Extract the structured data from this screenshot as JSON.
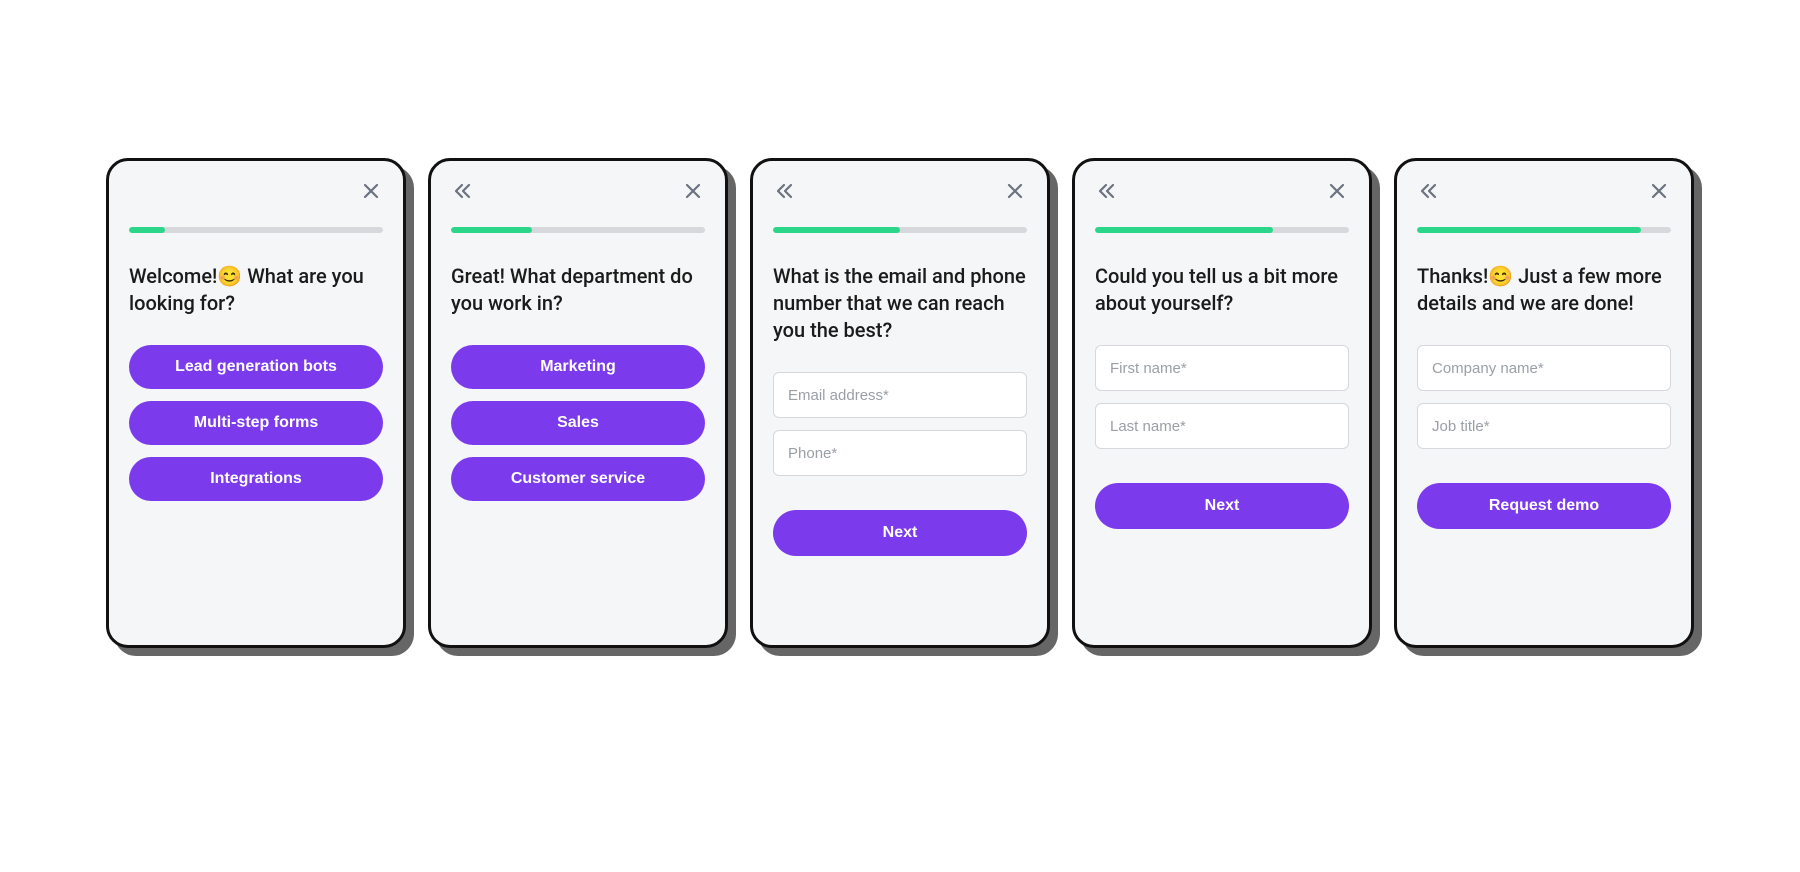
{
  "colors": {
    "accent": "#7c3aed",
    "progress": "#2bd68a",
    "track": "#d6d8dc"
  },
  "steps": [
    {
      "has_back": false,
      "progress_percent": 14,
      "prompt": "Welcome!😊 What are you looking for?",
      "type": "options",
      "options": [
        "Lead generation bots",
        "Multi-step forms",
        "Integrations"
      ]
    },
    {
      "has_back": true,
      "progress_percent": 32,
      "prompt": "Great! What department do you work in?",
      "type": "options",
      "options": [
        "Marketing",
        "Sales",
        "Customer service"
      ]
    },
    {
      "has_back": true,
      "progress_percent": 50,
      "prompt": "What is the email and phone number that we can reach you the best?",
      "type": "form",
      "fields": [
        {
          "placeholder": "Email address*"
        },
        {
          "placeholder": "Phone*"
        }
      ],
      "submit_label": "Next"
    },
    {
      "has_back": true,
      "progress_percent": 70,
      "prompt": "Could you tell us a bit more about yourself?",
      "type": "form",
      "fields": [
        {
          "placeholder": "First name*"
        },
        {
          "placeholder": "Last name*"
        }
      ],
      "submit_label": "Next"
    },
    {
      "has_back": true,
      "progress_percent": 88,
      "prompt": "Thanks!😊 Just a few more details and we are done!",
      "type": "form",
      "fields": [
        {
          "placeholder": "Company name*"
        },
        {
          "placeholder": "Job title*"
        }
      ],
      "submit_label": "Request demo"
    }
  ]
}
